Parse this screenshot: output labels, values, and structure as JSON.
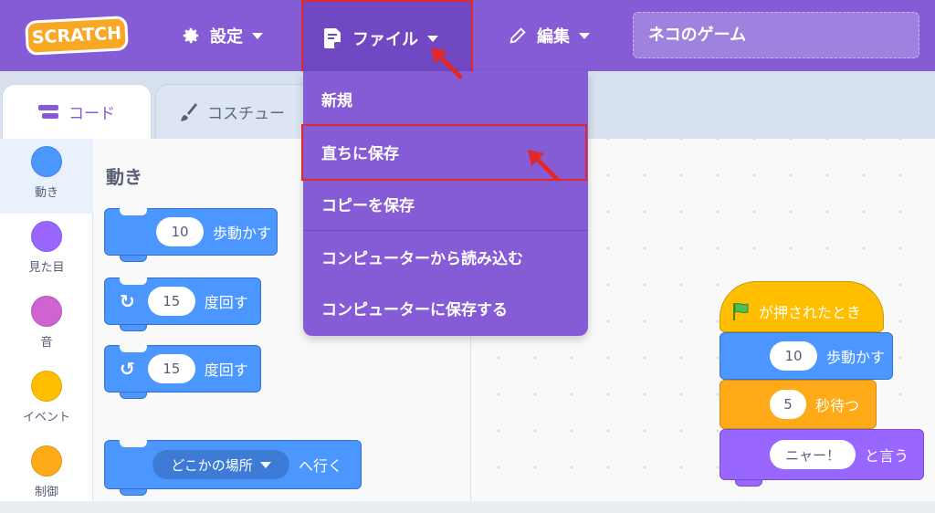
{
  "menubar": {
    "logo": "SCRATCH",
    "settings_label": "設定",
    "file_label": "ファイル",
    "edit_label": "編集",
    "project_title": "ネコのゲーム"
  },
  "tabs": {
    "code": "コード",
    "costumes": "コスチュー"
  },
  "categories": [
    {
      "label": "動き",
      "color": "#4c97ff"
    },
    {
      "label": "見た目",
      "color": "#9966ff"
    },
    {
      "label": "音",
      "color": "#cf63cf"
    },
    {
      "label": "イベント",
      "color": "#ffbf00"
    },
    {
      "label": "制御",
      "color": "#ffab19"
    }
  ],
  "palette": {
    "heading": "動き",
    "blocks": [
      {
        "value": "10",
        "text": "歩動かす"
      },
      {
        "value": "15",
        "text": "度回す"
      },
      {
        "value": "15",
        "text": "度回す"
      },
      {
        "value": "どこかの場所",
        "text": "へ行く"
      }
    ]
  },
  "file_menu": {
    "items": [
      "新規",
      "直ちに保存",
      "コピーを保存",
      "コンピューターから読み込む",
      "コンピューターに保存する"
    ]
  },
  "script": {
    "hat": "が押されたとき",
    "move_value": "10",
    "move_text": "歩動かす",
    "wait_value": "5",
    "wait_text": "秒待つ",
    "say_value": "ニャー！",
    "say_text": "と言う"
  },
  "colors": {
    "menubar": "#855cd6",
    "motion": "#4c97ff",
    "events": "#ffbf00",
    "control": "#ffab19",
    "looks": "#9966ff",
    "highlight": "#e02828"
  }
}
